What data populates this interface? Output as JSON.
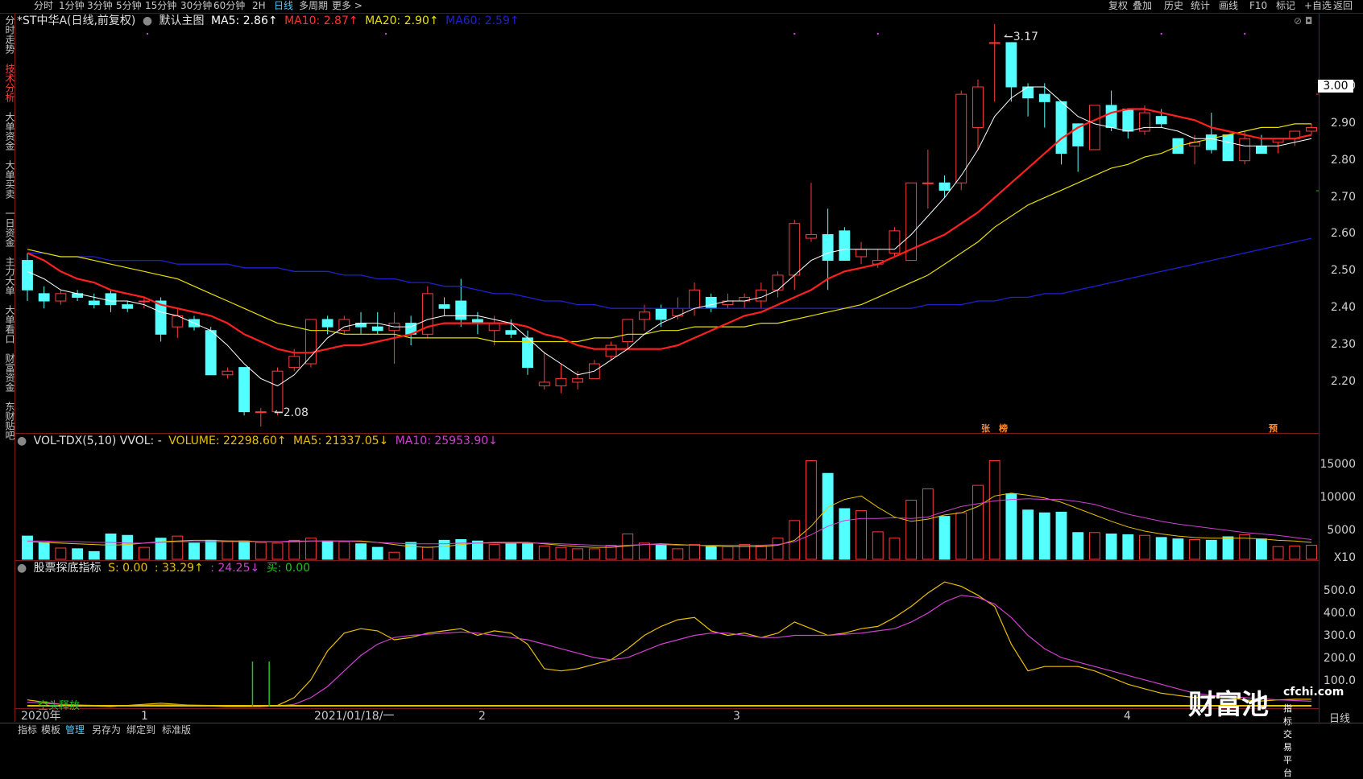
{
  "toolbar": {
    "periods": [
      "分时",
      "1分钟",
      "3分钟",
      "5分钟",
      "15分钟",
      "30分钟",
      "60分钟",
      "2H",
      "日线",
      "多周期",
      "更多 >"
    ],
    "active_period": "日线",
    "right_buttons": [
      "复权",
      "叠加",
      "历史",
      "统计",
      "画线",
      "F10",
      "标记",
      "+自选",
      "返回"
    ]
  },
  "sidebar": {
    "items": [
      "分时走势",
      "技术分析",
      "大单资金",
      "大单买卖",
      "一日资金",
      "主力大单",
      "大单看口",
      "财富资金",
      "东财贴吧"
    ],
    "active": "技术分析"
  },
  "main_legend": {
    "stock": "*ST中华A(日线,前复权)",
    "template": "默认主图",
    "ma5": "MA5: 2.86↑",
    "ma10": "MA10: 2.87↑",
    "ma20": "MA20: 2.90↑",
    "ma60": "MA60: 2.59↑"
  },
  "price_axis": [
    "3.00",
    "2.90",
    "2.80",
    "2.70",
    "2.60",
    "2.50",
    "2.40",
    "2.30",
    "2.20"
  ],
  "current_price_tag": "3.00",
  "annotations": {
    "high": "3.17",
    "low": "2.08",
    "zhang": "张",
    "bang": "榜",
    "yu": "预"
  },
  "vol_legend": {
    "name": "VOL-TDX(5,10) VVOL: -",
    "volume": "VOLUME: 22298.60↑",
    "ma5": "MA5: 21337.05↓",
    "ma10": "MA10: 25953.90↓"
  },
  "vol_axis": [
    "15000",
    "10000",
    "5000",
    "X10"
  ],
  "ind_legend": {
    "name": "股票探底指标",
    "s": "S: 0.00",
    "v1": ": 33.29↑",
    "v2": ": 24.25↓",
    "buy": "买: 0.00"
  },
  "ind_axis": [
    "500.0",
    "400.0",
    "300.0",
    "200.0",
    "100.0"
  ],
  "ind_text": "空头释放",
  "dates": [
    "2020年",
    "1",
    "2021/01/18/一",
    "2",
    "3",
    "4"
  ],
  "bottom_tabs": [
    "指标",
    "模板",
    "管理",
    "另存为",
    "绑定到",
    "标准版"
  ],
  "active_tab": "管理",
  "period_label": "日线",
  "watermark": {
    "brand": "财富池",
    "site": "cfchi.com",
    "slogan": "指标交易平台"
  },
  "colors": {
    "up": "#ff3b3b",
    "down": "#54ffff",
    "ma5": "#ffffff",
    "ma10": "#ff2020",
    "ma20": "#e8e000",
    "ma60": "#2020d0",
    "magenta": "#d040d0"
  },
  "chart_data": {
    "type": "candlestick",
    "candles": [
      [
        2.53,
        2.55,
        2.42,
        2.45
      ],
      [
        2.44,
        2.46,
        2.4,
        2.42
      ],
      [
        2.42,
        2.45,
        2.41,
        2.44
      ],
      [
        2.44,
        2.45,
        2.42,
        2.43
      ],
      [
        2.42,
        2.44,
        2.4,
        2.41
      ],
      [
        2.44,
        2.45,
        2.39,
        2.41
      ],
      [
        2.41,
        2.42,
        2.39,
        2.4
      ],
      [
        2.42,
        2.43,
        2.4,
        2.42
      ],
      [
        2.42,
        2.43,
        2.31,
        2.33
      ],
      [
        2.35,
        2.4,
        2.32,
        2.38
      ],
      [
        2.37,
        2.38,
        2.34,
        2.35
      ],
      [
        2.34,
        2.35,
        2.22,
        2.22
      ],
      [
        2.22,
        2.24,
        2.21,
        2.23
      ],
      [
        2.24,
        2.24,
        2.11,
        2.12
      ],
      [
        2.12,
        2.13,
        2.08,
        2.12
      ],
      [
        2.12,
        2.24,
        2.11,
        2.23
      ],
      [
        2.24,
        2.29,
        2.23,
        2.27
      ],
      [
        2.25,
        2.37,
        2.24,
        2.37
      ],
      [
        2.37,
        2.38,
        2.33,
        2.35
      ],
      [
        2.34,
        2.38,
        2.33,
        2.37
      ],
      [
        2.36,
        2.39,
        2.33,
        2.35
      ],
      [
        2.35,
        2.39,
        2.33,
        2.34
      ],
      [
        2.34,
        2.39,
        2.25,
        2.36
      ],
      [
        2.36,
        2.38,
        2.3,
        2.33
      ],
      [
        2.33,
        2.46,
        2.32,
        2.44
      ],
      [
        2.41,
        2.43,
        2.38,
        2.4
      ],
      [
        2.42,
        2.48,
        2.35,
        2.37
      ],
      [
        2.37,
        2.39,
        2.33,
        2.36
      ],
      [
        2.34,
        2.38,
        2.3,
        2.36
      ],
      [
        2.34,
        2.37,
        2.32,
        2.33
      ],
      [
        2.32,
        2.34,
        2.22,
        2.24
      ],
      [
        2.19,
        2.28,
        2.18,
        2.2
      ],
      [
        2.19,
        2.25,
        2.17,
        2.21
      ],
      [
        2.2,
        2.23,
        2.18,
        2.21
      ],
      [
        2.21,
        2.26,
        2.21,
        2.25
      ],
      [
        2.27,
        2.31,
        2.26,
        2.3
      ],
      [
        2.31,
        2.37,
        2.29,
        2.37
      ],
      [
        2.37,
        2.41,
        2.34,
        2.39
      ],
      [
        2.4,
        2.41,
        2.35,
        2.37
      ],
      [
        2.38,
        2.43,
        2.37,
        2.4
      ],
      [
        2.4,
        2.47,
        2.38,
        2.45
      ],
      [
        2.43,
        2.44,
        2.39,
        2.4
      ],
      [
        2.41,
        2.44,
        2.4,
        2.42
      ],
      [
        2.42,
        2.44,
        2.4,
        2.43
      ],
      [
        2.42,
        2.47,
        2.4,
        2.45
      ],
      [
        2.45,
        2.5,
        2.43,
        2.49
      ],
      [
        2.49,
        2.64,
        2.45,
        2.63
      ],
      [
        2.59,
        2.74,
        2.58,
        2.6
      ],
      [
        2.6,
        2.67,
        2.45,
        2.53
      ],
      [
        2.61,
        2.62,
        2.53,
        2.53
      ],
      [
        2.54,
        2.58,
        2.52,
        2.56
      ],
      [
        2.52,
        2.56,
        2.51,
        2.53
      ],
      [
        2.55,
        2.62,
        2.54,
        2.61
      ],
      [
        2.53,
        2.74,
        2.53,
        2.74
      ],
      [
        2.74,
        2.83,
        2.67,
        2.74
      ],
      [
        2.74,
        2.76,
        2.7,
        2.72
      ],
      [
        2.74,
        2.99,
        2.72,
        2.98
      ],
      [
        2.89,
        3.02,
        2.83,
        3.0
      ],
      [
        3.12,
        3.17,
        2.96,
        3.12
      ],
      [
        3.12,
        3.12,
        2.96,
        3.0
      ],
      [
        3.0,
        3.01,
        2.92,
        2.97
      ],
      [
        2.98,
        3.01,
        2.89,
        2.96
      ],
      [
        2.96,
        2.96,
        2.79,
        2.82
      ],
      [
        2.9,
        2.9,
        2.77,
        2.84
      ],
      [
        2.83,
        2.95,
        2.83,
        2.95
      ],
      [
        2.95,
        2.99,
        2.88,
        2.89
      ],
      [
        2.94,
        2.94,
        2.86,
        2.88
      ],
      [
        2.88,
        2.95,
        2.87,
        2.93
      ],
      [
        2.92,
        2.94,
        2.89,
        2.9
      ],
      [
        2.86,
        2.86,
        2.82,
        2.82
      ],
      [
        2.84,
        2.87,
        2.79,
        2.85
      ],
      [
        2.87,
        2.93,
        2.82,
        2.83
      ],
      [
        2.87,
        2.87,
        2.8,
        2.8
      ],
      [
        2.8,
        2.88,
        2.79,
        2.86
      ],
      [
        2.84,
        2.87,
        2.82,
        2.82
      ],
      [
        2.85,
        2.86,
        2.82,
        2.86
      ],
      [
        2.86,
        2.88,
        2.84,
        2.88
      ],
      [
        2.88,
        2.9,
        2.87,
        2.89
      ]
    ],
    "ma5": [
      2.5,
      2.48,
      2.45,
      2.44,
      2.43,
      2.42,
      2.42,
      2.41,
      2.39,
      2.38,
      2.36,
      2.34,
      2.3,
      2.25,
      2.21,
      2.19,
      2.22,
      2.27,
      2.32,
      2.35,
      2.36,
      2.36,
      2.35,
      2.35,
      2.37,
      2.38,
      2.38,
      2.38,
      2.37,
      2.36,
      2.32,
      2.28,
      2.25,
      2.22,
      2.23,
      2.26,
      2.29,
      2.33,
      2.36,
      2.38,
      2.4,
      2.41,
      2.42,
      2.42,
      2.43,
      2.45,
      2.49,
      2.53,
      2.55,
      2.56,
      2.56,
      2.56,
      2.56,
      2.6,
      2.65,
      2.7,
      2.76,
      2.83,
      2.92,
      2.97,
      3.0,
      3.0,
      2.96,
      2.92,
      2.9,
      2.89,
      2.88,
      2.89,
      2.89,
      2.88,
      2.86,
      2.86,
      2.85,
      2.84,
      2.84,
      2.84,
      2.85,
      2.86
    ],
    "ma10": [
      2.55,
      2.53,
      2.5,
      2.48,
      2.47,
      2.45,
      2.44,
      2.43,
      2.41,
      2.4,
      2.39,
      2.38,
      2.36,
      2.33,
      2.31,
      2.29,
      2.28,
      2.28,
      2.29,
      2.3,
      2.3,
      2.31,
      2.32,
      2.33,
      2.35,
      2.36,
      2.36,
      2.36,
      2.36,
      2.36,
      2.35,
      2.33,
      2.32,
      2.3,
      2.29,
      2.29,
      2.29,
      2.29,
      2.29,
      2.3,
      2.32,
      2.34,
      2.36,
      2.38,
      2.39,
      2.41,
      2.43,
      2.45,
      2.48,
      2.5,
      2.51,
      2.52,
      2.54,
      2.56,
      2.58,
      2.6,
      2.63,
      2.66,
      2.7,
      2.74,
      2.78,
      2.82,
      2.86,
      2.89,
      2.91,
      2.93,
      2.94,
      2.94,
      2.93,
      2.92,
      2.91,
      2.89,
      2.88,
      2.87,
      2.86,
      2.86,
      2.86,
      2.87
    ],
    "ma20": [
      2.56,
      2.55,
      2.54,
      2.54,
      2.53,
      2.52,
      2.51,
      2.5,
      2.49,
      2.48,
      2.46,
      2.44,
      2.42,
      2.4,
      2.38,
      2.36,
      2.35,
      2.34,
      2.34,
      2.33,
      2.33,
      2.33,
      2.33,
      2.32,
      2.32,
      2.32,
      2.32,
      2.32,
      2.31,
      2.31,
      2.31,
      2.31,
      2.31,
      2.31,
      2.32,
      2.32,
      2.33,
      2.33,
      2.34,
      2.34,
      2.35,
      2.35,
      2.35,
      2.35,
      2.36,
      2.36,
      2.37,
      2.38,
      2.39,
      2.4,
      2.41,
      2.43,
      2.45,
      2.47,
      2.49,
      2.52,
      2.55,
      2.58,
      2.62,
      2.65,
      2.68,
      2.7,
      2.72,
      2.74,
      2.76,
      2.78,
      2.79,
      2.81,
      2.82,
      2.84,
      2.85,
      2.86,
      2.87,
      2.88,
      2.89,
      2.89,
      2.9,
      2.9
    ],
    "ma60": [
      2.55,
      2.55,
      2.54,
      2.54,
      2.54,
      2.53,
      2.53,
      2.53,
      2.53,
      2.52,
      2.52,
      2.52,
      2.52,
      2.51,
      2.51,
      2.51,
      2.5,
      2.5,
      2.5,
      2.49,
      2.49,
      2.48,
      2.48,
      2.47,
      2.47,
      2.46,
      2.46,
      2.45,
      2.44,
      2.44,
      2.43,
      2.42,
      2.42,
      2.41,
      2.41,
      2.4,
      2.4,
      2.4,
      2.4,
      2.4,
      2.4,
      2.4,
      2.4,
      2.4,
      2.4,
      2.4,
      2.4,
      2.4,
      2.4,
      2.4,
      2.4,
      2.4,
      2.4,
      2.4,
      2.41,
      2.41,
      2.41,
      2.42,
      2.42,
      2.43,
      2.43,
      2.44,
      2.44,
      2.45,
      2.46,
      2.47,
      2.48,
      2.49,
      2.5,
      2.51,
      2.52,
      2.53,
      2.54,
      2.55,
      2.56,
      2.57,
      2.58,
      2.59
    ],
    "volume": [
      3300,
      2400,
      1600,
      1500,
      1100,
      3600,
      3400,
      1700,
      3000,
      3300,
      2300,
      2700,
      2600,
      2600,
      2400,
      2300,
      2700,
      3000,
      2600,
      2500,
      2200,
      1700,
      1000,
      2400,
      1700,
      2700,
      2800,
      2600,
      2100,
      2300,
      2300,
      1900,
      1700,
      1500,
      1500,
      2000,
      3600,
      2300,
      2100,
      1500,
      2100,
      1800,
      1800,
      2100,
      1900,
      3000,
      5500,
      14000,
      12200,
      7200,
      6900,
      3900,
      3000,
      8400,
      10000,
      6100,
      6600,
      10500,
      14000,
      9300,
      7000,
      6600,
      6700,
      3800,
      3800,
      3600,
      3500,
      3400,
      3100,
      2900,
      2800,
      2700,
      3200,
      3500,
      2900,
      1800,
      1900,
      2000
    ],
    "vol_ma5": [
      2500,
      2400,
      2300,
      2200,
      2100,
      2000,
      2100,
      2300,
      2500,
      2600,
      2700,
      2700,
      2600,
      2600,
      2500,
      2500,
      2500,
      2600,
      2600,
      2600,
      2600,
      2400,
      2100,
      1800,
      1700,
      1800,
      2100,
      2300,
      2400,
      2400,
      2400,
      2200,
      2000,
      1800,
      1700,
      1700,
      1900,
      2100,
      2200,
      2100,
      2000,
      1900,
      1800,
      1800,
      1800,
      2000,
      2700,
      4700,
      7400,
      8500,
      9000,
      7400,
      6000,
      5400,
      5700,
      6300,
      6600,
      7500,
      9000,
      9400,
      9100,
      8700,
      8100,
      7200,
      6300,
      5400,
      4600,
      4000,
      3600,
      3300,
      3100,
      3000,
      3000,
      3000,
      2900,
      2700,
      2600,
      2400
    ],
    "vol_ma10": [
      2600,
      2600,
      2500,
      2500,
      2400,
      2400,
      2300,
      2300,
      2400,
      2500,
      2500,
      2500,
      2500,
      2500,
      2500,
      2500,
      2600,
      2600,
      2600,
      2600,
      2500,
      2400,
      2300,
      2200,
      2200,
      2200,
      2300,
      2300,
      2300,
      2300,
      2300,
      2300,
      2200,
      2100,
      2000,
      1900,
      2000,
      2100,
      2100,
      2000,
      2000,
      2000,
      2000,
      2000,
      2000,
      2100,
      2500,
      3500,
      4700,
      5500,
      5800,
      5800,
      5900,
      5800,
      6000,
      6800,
      7500,
      7900,
      8300,
      8500,
      8600,
      8500,
      8500,
      8200,
      7800,
      7100,
      6400,
      5900,
      5400,
      5000,
      4700,
      4400,
      4100,
      3800,
      3600,
      3400,
      3100,
      2800
    ],
    "ind_s": [
      30,
      20,
      10,
      5,
      2,
      0,
      5,
      10,
      15,
      10,
      5,
      2,
      0,
      0,
      0,
      5,
      40,
      120,
      250,
      330,
      350,
      340,
      300,
      310,
      330,
      340,
      350,
      320,
      340,
      330,
      280,
      170,
      160,
      170,
      190,
      210,
      260,
      320,
      360,
      390,
      400,
      340,
      320,
      330,
      310,
      330,
      380,
      350,
      320,
      330,
      350,
      360,
      400,
      450,
      510,
      560,
      540,
      500,
      450,
      280,
      160,
      180,
      180,
      180,
      160,
      130,
      100,
      80,
      60,
      50,
      40,
      45,
      40,
      30,
      25,
      30,
      33,
      33
    ],
    "ind_m": [
      20,
      15,
      10,
      8,
      5,
      3,
      4,
      6,
      8,
      8,
      7,
      5,
      3,
      2,
      1,
      2,
      10,
      40,
      90,
      160,
      230,
      280,
      310,
      320,
      325,
      330,
      335,
      330,
      320,
      310,
      300,
      280,
      260,
      240,
      220,
      210,
      220,
      250,
      280,
      300,
      320,
      330,
      330,
      320,
      310,
      310,
      320,
      320,
      320,
      325,
      330,
      340,
      350,
      380,
      420,
      470,
      500,
      490,
      460,
      400,
      320,
      260,
      220,
      200,
      180,
      160,
      140,
      120,
      100,
      80,
      60,
      50,
      45,
      40,
      35,
      30,
      27,
      24
    ],
    "ylim": [
      2.08,
      3.17
    ]
  }
}
